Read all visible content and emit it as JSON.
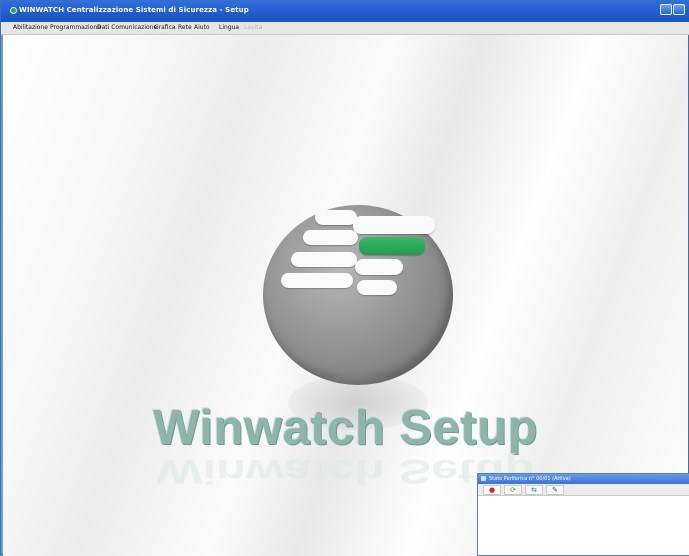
{
  "window": {
    "title": "WINWATCH Centralizzazione Sistemi di Sicurezza - Setup",
    "controls": [
      "minimize",
      "maximize"
    ]
  },
  "menu": [
    {
      "label": "Abilitazione",
      "enabled": true
    },
    {
      "label": "Programmazione",
      "enabled": true
    },
    {
      "label": "Dati Comunicazione",
      "enabled": true
    },
    {
      "label": "Grafica",
      "enabled": true
    },
    {
      "label": "Rete",
      "enabled": true
    },
    {
      "label": "Aiuto",
      "enabled": true
    },
    {
      "label": "Lingua",
      "enabled": true
    },
    {
      "label": "Lavita",
      "enabled": false
    }
  ],
  "splash": {
    "text": "Winwatch Setup",
    "colors": {
      "bars": "#fafafa",
      "accent_bar": "#2aa558",
      "text": "#8db5a9",
      "disc": "#8e8e8e"
    }
  },
  "child_window": {
    "title": "Stato Periferica n° 00/01 (Attiva)",
    "toolbar": [
      {
        "icon": "alarm-icon",
        "glyph": "●"
      },
      {
        "icon": "refresh-icon",
        "glyph": "⟳"
      },
      {
        "icon": "connect-icon",
        "glyph": "⇆"
      },
      {
        "icon": "settings-icon",
        "glyph": "✎"
      }
    ]
  }
}
